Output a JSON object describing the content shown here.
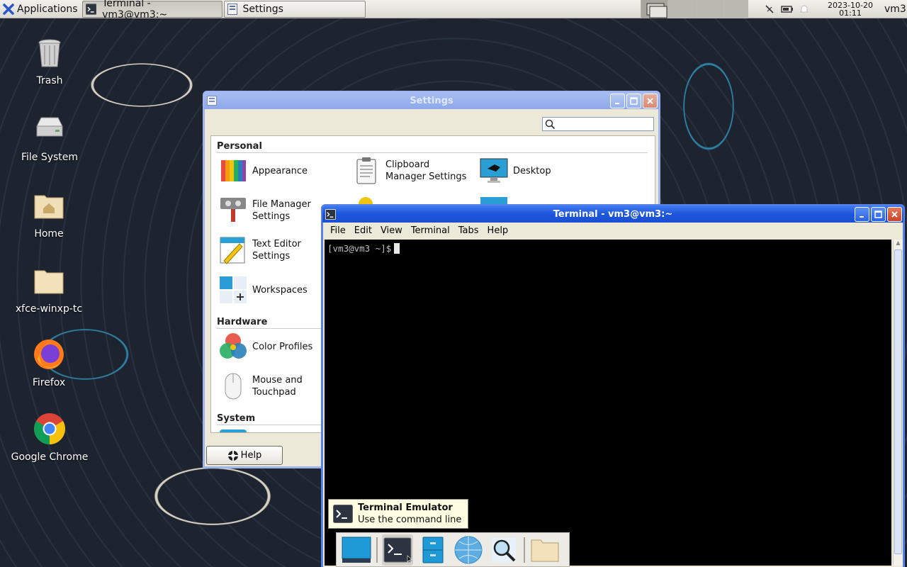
{
  "top_panel": {
    "applications_label": "Applications",
    "tasks": [
      {
        "label": "Terminal - vm3@vm3:~"
      },
      {
        "label": "Settings"
      }
    ],
    "clock_date": "2023-10-20",
    "clock_time": "01:11",
    "user": "vm3"
  },
  "desktop_icons": [
    {
      "label": "Trash",
      "icon": "trash-icon"
    },
    {
      "label": "File System",
      "icon": "harddisk-icon"
    },
    {
      "label": "Home",
      "icon": "home-folder-icon"
    },
    {
      "label": "xfce-winxp-tc",
      "icon": "folder-icon"
    },
    {
      "label": "Firefox",
      "icon": "firefox-icon"
    },
    {
      "label": "Google Chrome",
      "icon": "chrome-icon"
    }
  ],
  "settings": {
    "title": "Settings",
    "sections": {
      "personal": "Personal",
      "hardware": "Hardware",
      "system": "System"
    },
    "items": {
      "appearance": "Appearance",
      "clipboard": "Clipboard Manager Settings",
      "desktop": "Desktop",
      "file_manager": "File Manager Settings",
      "text_editor": "Text Editor Settings",
      "workspaces": "Workspaces",
      "color_profiles": "Color Profiles",
      "mouse": "Mouse and Touchpad"
    },
    "help_label": "Help"
  },
  "terminal": {
    "title": "Terminal - vm3@vm3:~",
    "menu": [
      "File",
      "Edit",
      "View",
      "Terminal",
      "Tabs",
      "Help"
    ],
    "prompt": "[vm3@vm3 ~]$"
  },
  "tooltip": {
    "title": "Terminal Emulator",
    "subtitle": "Use the command line"
  },
  "colors": {
    "titlebar_active": "#1d56dc",
    "titlebar_inactive": "#8ea8ea",
    "terminal_bg": "#000000"
  }
}
